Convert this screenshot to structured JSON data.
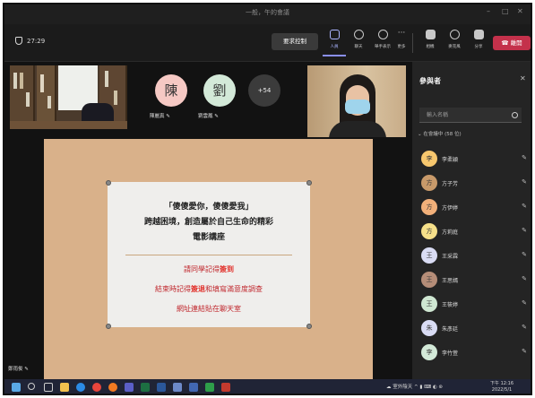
{
  "window": {
    "title": "一般，午的會議",
    "minimize": "–",
    "maximize": "□",
    "close": "✕"
  },
  "toolbar": {
    "timer": "27:29",
    "raise_hand": "要求控制",
    "buttons": [
      {
        "label": "人員",
        "icon": "people-icon"
      },
      {
        "label": "聊天",
        "icon": "chat-icon"
      },
      {
        "label": "舉手表示",
        "icon": "reactions-icon"
      },
      {
        "label": "檢視",
        "icon": "view-icon"
      },
      {
        "label": "更多",
        "icon": "more-icon"
      },
      {
        "label": "相機",
        "icon": "camera-icon"
      },
      {
        "label": "麥克風",
        "icon": "mic-off-icon"
      },
      {
        "label": "分享",
        "icon": "share-icon"
      }
    ],
    "leave": "離開"
  },
  "stage": {
    "avatars": [
      {
        "initial": "陳",
        "name": "陳麗真",
        "color": "#f6c9c4"
      },
      {
        "initial": "劉",
        "name": "劉雲鳳",
        "color": "#d3e9d8"
      }
    ],
    "more_count": "+54",
    "self_label": "鄭雨俊"
  },
  "slide": {
    "title_lines": [
      "「傻傻愛你，傻傻愛我」",
      "跨越困境，創造屬於自己生命的精彩",
      "電影講座"
    ],
    "red_lines": [
      {
        "text": "請同學記得",
        "bold": "簽到",
        "after": ""
      },
      {
        "text": "結束時記得",
        "bold": "簽退",
        "after": "和填寫滿意度調查"
      },
      {
        "text": "網址連結貼在聊天室",
        "bold": "",
        "after": ""
      }
    ]
  },
  "panel": {
    "title": "參與者",
    "close": "✕",
    "search_placeholder": "輸入名稱",
    "group": "⌄ 在會議中 (58 位)",
    "participants": [
      {
        "initial": "李",
        "name": "李柔穎",
        "color": "#f7c76e",
        "mic": "🎙"
      },
      {
        "initial": "方",
        "name": "方子芳",
        "color": "#c89a6a",
        "mic": "🎙"
      },
      {
        "initial": "方",
        "name": "方伊婷",
        "color": "#f2b07a",
        "mic": "🎙"
      },
      {
        "initial": "方",
        "name": "方莉庭",
        "color": "#f6e08a",
        "mic": "🎙"
      },
      {
        "initial": "王",
        "name": "王采霖",
        "color": "#d9dcf4",
        "mic": "🎙"
      },
      {
        "initial": "王",
        "name": "王思嫣",
        "color": "#b58d78",
        "mic": "🎙"
      },
      {
        "initial": "王",
        "name": "王筱婷",
        "color": "#cfe7d2",
        "mic": "🎙"
      },
      {
        "initial": "朱",
        "name": "朱彥廷",
        "color": "#d9dcf4",
        "mic": "🎙"
      },
      {
        "initial": "李",
        "name": "李竹萱",
        "color": "#d3e9d8",
        "mic": "🎙"
      }
    ]
  },
  "taskbar": {
    "weather": "室外陰天",
    "clock_time": "下午 12:16",
    "clock_date": "2022/5/1"
  },
  "colors": {
    "accent": "#8a8ff5",
    "leave_red": "#c4314b",
    "slide_bg": "#d9b18a",
    "slide_red": "#c0272d"
  }
}
